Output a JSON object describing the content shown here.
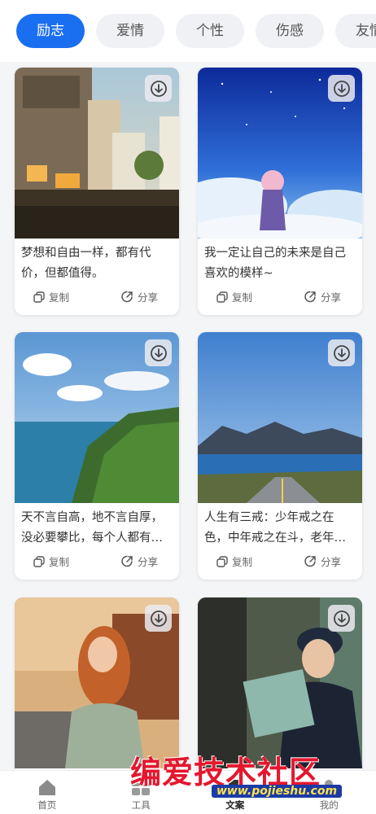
{
  "tabs": [
    "励志",
    "爱情",
    "个性",
    "伤感",
    "友情"
  ],
  "active_tab_index": 0,
  "cards": [
    {
      "text": "梦想和自由一样，都有代价，但都值得。",
      "image": "old-town-street"
    },
    {
      "text": "我一定让自己的未来是自己喜欢的模样~",
      "image": "anime-girl-sky"
    },
    {
      "text": "天不言自高，地不言自厚，没必要攀比，每个人都有自己的精彩。",
      "image": "sea-cliff"
    },
    {
      "text": "人生有三戒：少年戒之在色，中年戒之在斗，老年戒之在得。",
      "image": "mountain-lake-road"
    },
    {
      "text": "",
      "image": "red-hair-girl"
    },
    {
      "text": "",
      "image": "woman-reading-subway"
    }
  ],
  "actions": {
    "copy": "复制",
    "share": "分享"
  },
  "nav": {
    "items": [
      {
        "label": "首页",
        "icon": "home-icon"
      },
      {
        "label": "工具",
        "icon": "grid-icon"
      },
      {
        "label": "文案",
        "icon": "text-icon"
      },
      {
        "label": "我的",
        "icon": "user-icon"
      }
    ],
    "active_index": 2
  },
  "watermark": {
    "title": "编爱技术社区",
    "url": "www.pojieshu.com"
  },
  "colors": {
    "accent": "#1a6ef0",
    "tab_bg": "#f0f1f4",
    "watermark_red": "#e4172f"
  }
}
